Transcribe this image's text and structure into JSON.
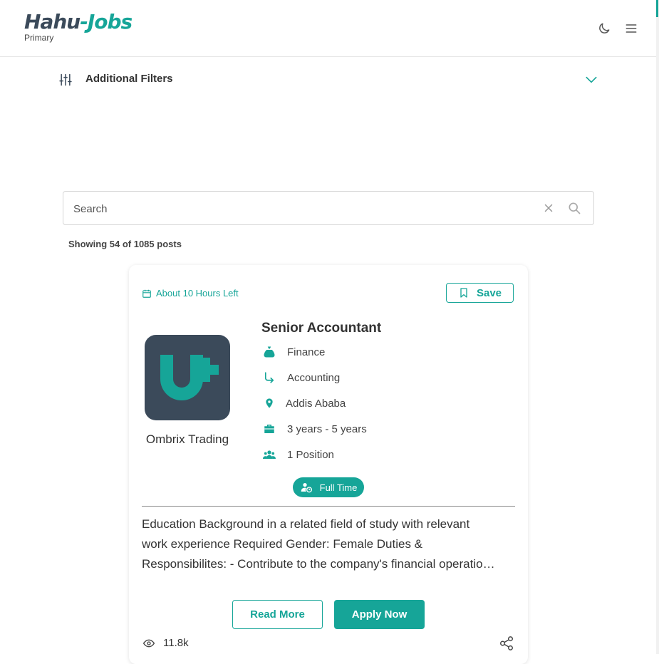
{
  "header": {
    "logo": {
      "part1": "Hahu",
      "part2": "-",
      "part3": "Jobs"
    },
    "subtitle": "Primary",
    "theme_icon": "moon-icon",
    "menu_icon": "hamburger-menu-icon"
  },
  "filters": {
    "label": "Additional Filters",
    "icon": "sliders-icon",
    "toggle_icon": "chevron-down-icon"
  },
  "search": {
    "placeholder": "Search",
    "value": "",
    "clear_icon": "close-icon",
    "search_icon": "search-icon"
  },
  "results": {
    "showing": "Showing 54 of 1085 posts"
  },
  "job": {
    "deadline": "About 10 Hours Left",
    "save_label": "Save",
    "company": "Ombrix Trading",
    "title": "Senior Accountant",
    "category": "Finance",
    "subcategory": "Accounting",
    "location": "Addis Ababa",
    "experience": "3 years - 5 years",
    "positions": "1 Position",
    "employment_type": "Full Time",
    "description": "Education Background in a related field of study with relevant work experience Required Gender: Female Duties & Responsibilites: - Contribute to the company's financial operations and reporting.",
    "read_more_label": "Read More",
    "apply_label": "Apply Now",
    "views": "11.8k"
  },
  "colors": {
    "accent": "#16a598",
    "dark": "#3b4a5a"
  }
}
